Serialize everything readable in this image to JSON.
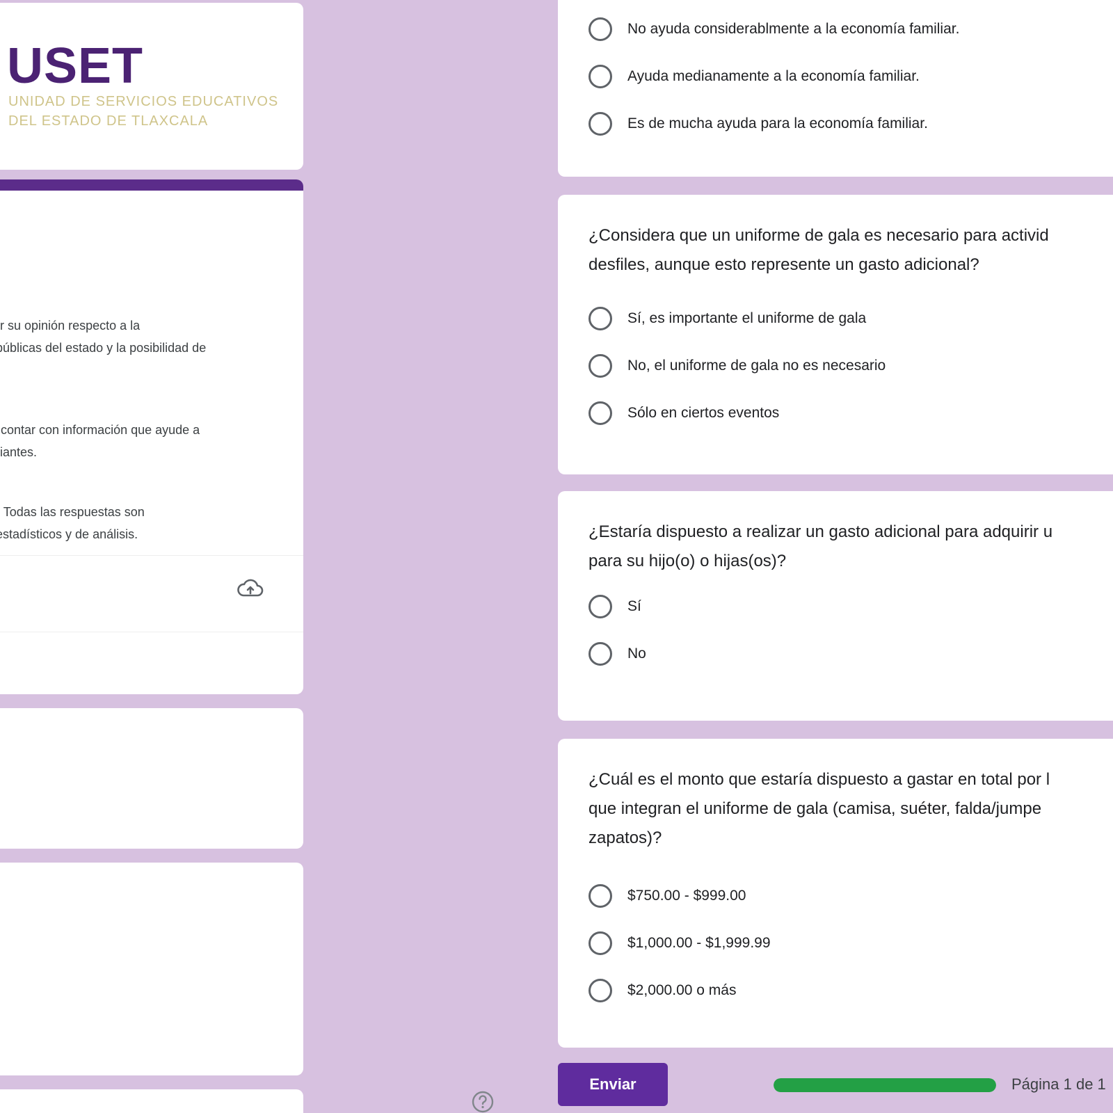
{
  "logo": {
    "word": "USET",
    "subtitle_line1": "UNIDAD DE SERVICIOS EDUCATIVOS",
    "subtitle_line2": "DEL ESTADO DE TLAXCALA"
  },
  "intro": {
    "lines": [
      "bar su opinión respecto a la",
      "s públicas del estado y la posibilidad de",
      "rá contar con información que ayude a",
      "udiantes.",
      "ta. Todas las respuestas son",
      "s estadísticos y de análisis."
    ]
  },
  "questions": [
    {
      "title": "",
      "options": [
        "No ayuda considerablmente a la economía familiar.",
        "Ayuda medianamente a la economía familiar.",
        "Es de mucha ayuda para la economía familiar."
      ]
    },
    {
      "title": "¿Considera que un uniforme de gala es necesario para activid\ndesfiles, aunque esto represente un gasto adicional?",
      "options": [
        "Sí, es importante el uniforme de gala",
        "No, el uniforme de gala no es necesario",
        "Sólo en ciertos eventos"
      ]
    },
    {
      "title": "¿Estaría dispuesto a realizar un gasto adicional para adquirir u\npara su hijo(o) o hijas(os)?",
      "options": [
        "Sí",
        "No"
      ]
    },
    {
      "title": "¿Cuál es el monto que estaría dispuesto a gastar en total por l\nque integran el uniforme de gala (camisa, suéter, falda/jumpe\nzapatos)?",
      "options": [
        "$750.00 - $999.00",
        "$1,000.00 - $1,999.99",
        "$2,000.00 o más"
      ]
    }
  ],
  "footer": {
    "submit_label": "Enviar",
    "progress": 1.0,
    "page_indicator": "Página 1 de 1"
  },
  "icons": {
    "upload": "cloud-upload-icon",
    "help": "help-icon"
  },
  "colors": {
    "background": "#d7c1e0",
    "accent": "#5f2c9e",
    "progress": "#23a045"
  }
}
